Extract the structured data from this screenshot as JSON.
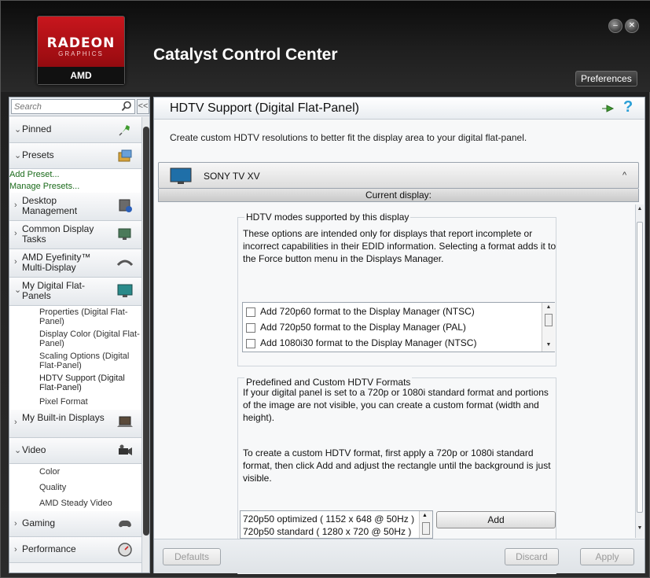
{
  "window": {
    "app_title": "Catalyst Control Center",
    "preferences_label": "Preferences",
    "logo": {
      "line1": "RADEON",
      "line2": "GRAPHICS",
      "line3": "AMD"
    }
  },
  "sidebar": {
    "search_placeholder": "Search",
    "collapse_label": "<<",
    "items": [
      {
        "label": "Pinned",
        "chev": "v",
        "icon": "pin-icon"
      },
      {
        "label": "Presets",
        "chev": "v",
        "icon": "presets-icon"
      },
      {
        "label": "Desktop Management",
        "chev": ">",
        "icon": "desktop-management-icon"
      },
      {
        "label": "Common Display Tasks",
        "chev": ">",
        "icon": "display-tasks-icon"
      },
      {
        "label": "AMD Eyefinity™ Multi-Display",
        "chev": ">",
        "icon": "eyefinity-icon"
      },
      {
        "label": "My Digital Flat-Panels",
        "chev": "v",
        "icon": "flat-panel-icon"
      },
      {
        "label": "My Built-in Displays",
        "chev": ">",
        "icon": "laptop-icon"
      },
      {
        "label": "Video",
        "chev": "v",
        "icon": "video-camera-icon"
      },
      {
        "label": "Gaming",
        "chev": ">",
        "icon": "gamepad-icon"
      },
      {
        "label": "Performance",
        "chev": ">",
        "icon": "speedometer-icon"
      }
    ],
    "preset_links": [
      "Add Preset...",
      "Manage Presets..."
    ],
    "flat_panel_subitems": [
      "Properties (Digital Flat-Panel)",
      "Display Color (Digital Flat-Panel)",
      "Scaling Options (Digital Flat-Panel)",
      "HDTV Support (Digital Flat-Panel)",
      "Pixel Format"
    ],
    "video_subitems": [
      "Color",
      "Quality",
      "AMD Steady Video"
    ]
  },
  "main": {
    "page_title": "HDTV Support (Digital Flat-Panel)",
    "description": "Create custom HDTV resolutions to better fit the display area to your digital flat-panel.",
    "display_name": "SONY TV XV",
    "current_display_label": "Current display:",
    "modes_group": {
      "title": "HDTV modes supported by this display",
      "text": "These options are intended only for displays that report incomplete or incorrect capabilities in their EDID information. Selecting a format adds it to the Force button menu in the Displays Manager.",
      "options": [
        {
          "label": "Add 720p60 format to the Display Manager (NTSC)",
          "checked": false
        },
        {
          "label": "Add 720p50 format to the Display Manager (PAL)",
          "checked": false
        },
        {
          "label": "Add 1080i30 format to the Display Manager (NTSC)",
          "checked": false
        }
      ]
    },
    "formats_group": {
      "title": "Predefined and Custom HDTV Formats",
      "text1": "If your digital panel is set to a 720p or 1080i standard format and portions of the image are not visible, you can create a custom format (width and height).",
      "text2": "To create a custom HDTV format, first apply a 720p or 1080i standard format, then click Add and adjust the rectangle until the background is just visible.",
      "formats": [
        "720p50 optimized ( 1152 x 648 @ 50Hz )",
        "720p50 standard ( 1280 x 720 @ 50Hz )"
      ],
      "add_label": "Add"
    }
  },
  "footer": {
    "defaults_label": "Defaults",
    "discard_label": "Discard",
    "apply_label": "Apply"
  }
}
